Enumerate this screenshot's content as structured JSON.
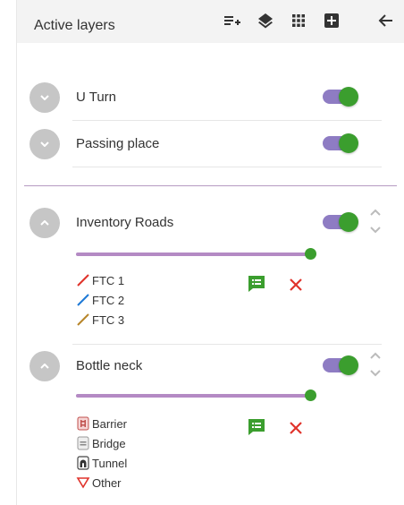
{
  "header": {
    "title": "Active layers",
    "icons": [
      "add-layer-icon",
      "layers-icon",
      "grid-icon",
      "add-box-icon",
      "back-arrow-icon"
    ]
  },
  "layers": [
    {
      "name": "U Turn",
      "enabled": true,
      "expanded": false
    },
    {
      "name": "Passing place",
      "enabled": true,
      "expanded": false
    },
    {
      "name": "Inventory Roads",
      "enabled": true,
      "expanded": true,
      "opacity": 1.0,
      "legend": [
        {
          "label": "FTC 1",
          "symbol": "line-red"
        },
        {
          "label": "FTC 2",
          "symbol": "line-blue"
        },
        {
          "label": "FTC 3",
          "symbol": "line-brown"
        }
      ]
    },
    {
      "name": "Bottle neck",
      "enabled": true,
      "expanded": true,
      "opacity": 1.0,
      "legend": [
        {
          "label": "Barrier",
          "symbol": "barrier-icon"
        },
        {
          "label": "Bridge",
          "symbol": "bridge-icon"
        },
        {
          "label": "Tunnel",
          "symbol": "tunnel-icon"
        },
        {
          "label": "Other",
          "symbol": "triangle-down-icon"
        }
      ]
    }
  ],
  "colors": {
    "header_bg": "#f3f3f3",
    "toggle_track": "#8e7cc3",
    "toggle_knob": "#3b9e2e",
    "slider_track": "#b48ac4",
    "accent_green": "#3b9e2e",
    "delete_red": "#e0332b",
    "divider": "#b69bc2"
  }
}
